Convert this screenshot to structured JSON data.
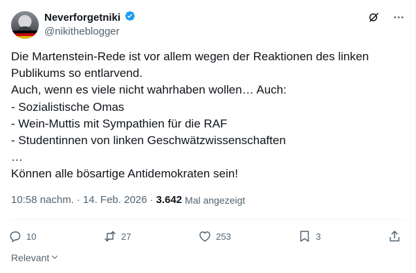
{
  "author": {
    "display_name": "Neverforgetniki",
    "handle": "@nikitheblogger",
    "verified_icon": "verified-badge-icon",
    "verified_color": "#1d9bf0"
  },
  "tweet": {
    "text": "Die Martenstein-Rede ist vor allem wegen der Reaktionen des linken\nPublikums so entlarvend.\nAuch, wenn es viele nicht wahrhaben wollen… Auch:\n- Sozialistische Omas\n- Wein-Muttis mit Sympathien für die RAF\n- Studentinnen von linken Geschwätzwissenschaften\n…\nKönnen alle bösartige Antidemokraten sein!",
    "timestamp": "10:58 nachm.",
    "separator": "·",
    "date": "14. Feb. 2026",
    "views": "3.642",
    "views_label": "Mal angezeigt"
  },
  "actions": {
    "replies": "10",
    "reposts": "27",
    "likes": "253",
    "bookmarks": "3"
  },
  "sort": {
    "label": "Relevant"
  },
  "colors": {
    "text": "#0f1419",
    "secondary": "#536471",
    "divider": "#eff3f4"
  }
}
